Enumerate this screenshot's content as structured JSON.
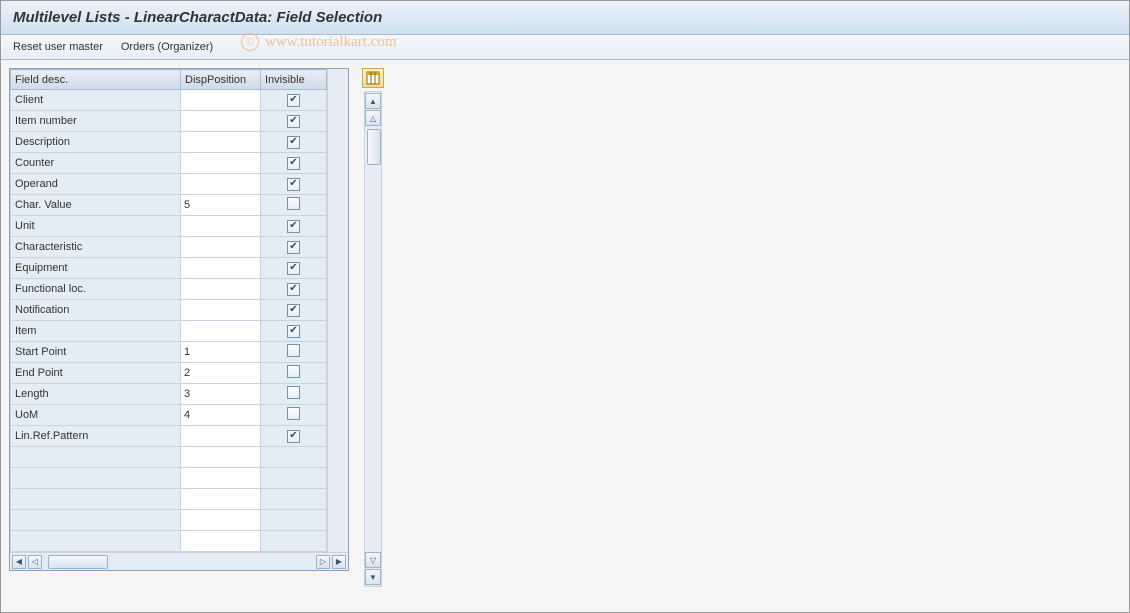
{
  "title": "Multilevel Lists - LinearCharactData: Field Selection",
  "toolbar": {
    "reset_label": "Reset user master",
    "orders_label": "Orders (Organizer)"
  },
  "watermark": "www.tutorialkart.com",
  "columns": {
    "field_desc": "Field desc.",
    "disp_position": "DispPosition",
    "invisible": "Invisible"
  },
  "rows": [
    {
      "desc": "Client",
      "pos": "",
      "inv": true
    },
    {
      "desc": "Item number",
      "pos": "",
      "inv": true
    },
    {
      "desc": "Description",
      "pos": "",
      "inv": true
    },
    {
      "desc": "Counter",
      "pos": "",
      "inv": true
    },
    {
      "desc": "Operand",
      "pos": "",
      "inv": true
    },
    {
      "desc": "Char. Value",
      "pos": "5",
      "inv": false
    },
    {
      "desc": "Unit",
      "pos": "",
      "inv": true
    },
    {
      "desc": "Characteristic",
      "pos": "",
      "inv": true
    },
    {
      "desc": "Equipment",
      "pos": "",
      "inv": true
    },
    {
      "desc": "Functional loc.",
      "pos": "",
      "inv": true
    },
    {
      "desc": "Notification",
      "pos": "",
      "inv": true
    },
    {
      "desc": "Item",
      "pos": "",
      "inv": true
    },
    {
      "desc": "Start Point",
      "pos": "1",
      "inv": false
    },
    {
      "desc": "End Point",
      "pos": "2",
      "inv": false
    },
    {
      "desc": "Length",
      "pos": "3",
      "inv": false
    },
    {
      "desc": "UoM",
      "pos": "4",
      "inv": false
    },
    {
      "desc": "Lin.Ref.Pattern",
      "pos": "",
      "inv": true
    }
  ],
  "empty_rows": 5,
  "icons": {
    "config": "table-layout-icon"
  }
}
